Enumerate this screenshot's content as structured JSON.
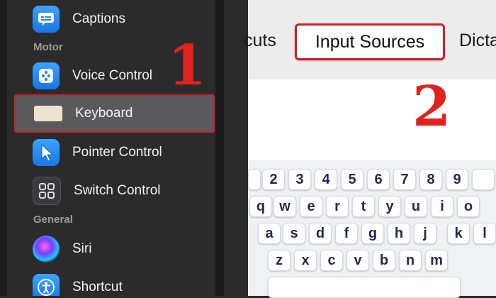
{
  "sidebar": {
    "captions_label": "Captions",
    "section_motor": "Motor",
    "voice_control_label": "Voice Control",
    "keyboard_label": "Keyboard",
    "pointer_control_label": "Pointer Control",
    "switch_control_label": "Switch Control",
    "section_general": "General",
    "siri_label": "Siri",
    "shortcut_label": "Shortcut"
  },
  "tabs": {
    "left_partial": "cuts",
    "active": "Input Sources",
    "right_partial": "Dicta"
  },
  "markers": {
    "one": "1",
    "two": "2"
  },
  "keyboard": {
    "row1": [
      "2",
      "3",
      "4",
      "5",
      "6",
      "7",
      "8",
      "9"
    ],
    "row2": [
      "q",
      "w",
      "e",
      "r",
      "t",
      "y",
      "u",
      "i",
      "o"
    ],
    "row3": [
      "a",
      "s",
      "d",
      "f",
      "g",
      "h",
      "j",
      "k",
      "l"
    ],
    "row4": [
      "z",
      "x",
      "c",
      "v",
      "b",
      "n",
      "m"
    ]
  },
  "colors": {
    "highlight": "#cc2026",
    "marker": "#e1231f",
    "key_text": "#1e2a55"
  }
}
